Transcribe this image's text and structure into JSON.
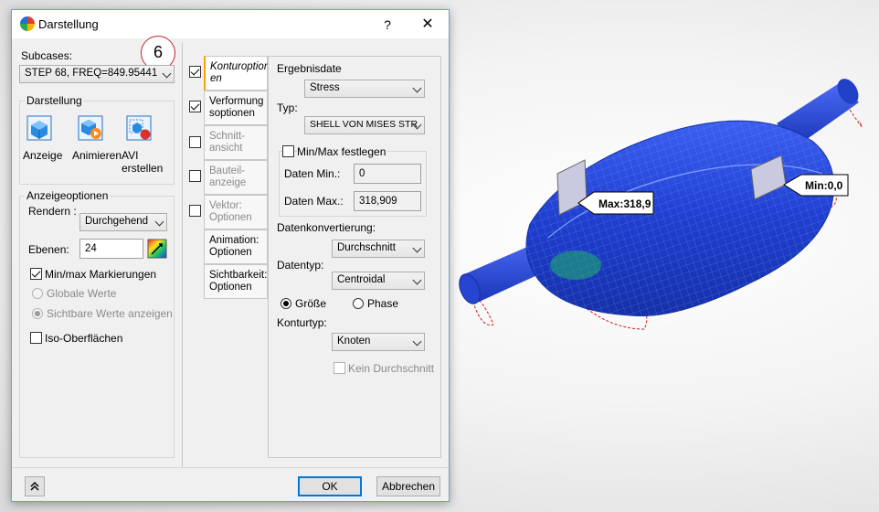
{
  "dialog": {
    "title": "Darstellung",
    "help_label": "?",
    "close_label": "✕",
    "callout_number": "6"
  },
  "left": {
    "subcases_label": "Subcases:",
    "subcase_value": "STEP 68, FREQ=849.95441",
    "darstellung_group": "Darstellung",
    "buttons": {
      "anzeige": "Anzeige",
      "animieren": "Animieren",
      "avi_line1": "AVI",
      "avi_line2": "erstellen"
    },
    "anzeigeoptionen_group": "Anzeigeoptionen",
    "rendern_label": "Rendern :",
    "rendern_value": "Durchgehend",
    "ebenen_label": "Ebenen:",
    "ebenen_value": "24",
    "minmax_label": "Min/max Markierungen",
    "globale_werte": "Globale Werte",
    "sichtbare_werte": "Sichtbare Werte anzeigen",
    "iso_label": "Iso-Oberflächen"
  },
  "tabs": [
    {
      "line1": "Konturoption",
      "line2": "en"
    },
    {
      "line1": "Verformung",
      "line2": "soptionen"
    },
    {
      "line1": "Schnitt-",
      "line2": "ansicht"
    },
    {
      "line1": "Bauteil-",
      "line2": "anzeige"
    },
    {
      "line1": "Vektor:",
      "line2": "Optionen"
    },
    {
      "line1": "Animation:",
      "line2": "Optionen"
    },
    {
      "line1": "Sichtbarkeit:",
      "line2": "Optionen"
    }
  ],
  "contour": {
    "ergebnisdatei_label": "Ergebnisdate",
    "ergebnisdatei_value": "Stress",
    "typ_label": "Typ:",
    "typ_value": "SHELL VON MISES STR",
    "minmax_fix_label": "Min/Max festlegen",
    "daten_min_label": "Daten Min.:",
    "daten_min_value": "0",
    "daten_max_label": "Daten Max.:",
    "daten_max_value": "318,909",
    "datenkonv_label": "Datenkonvertierung:",
    "datenkonv_value": "Durchschnitt",
    "datentyp_label": "Datentyp:",
    "datentyp_value": "Centroidal",
    "groesse_label": "Größe",
    "phase_label": "Phase",
    "konturtyp_label": "Konturtyp:",
    "konturtyp_value": "Knoten",
    "kein_durchschnitt_label": "Kein Durchschnitt"
  },
  "footer": {
    "ok_label": "OK",
    "abbrechen_label": "Abbrechen",
    "collapse_icon": "double-chevron-up-icon"
  },
  "viewport": {
    "max_label": "Max:318,9",
    "min_label": "Min:0,0"
  },
  "colors": {
    "mesh_blue": "#1f3fd0",
    "accent_orange": "#ffa000",
    "callout_red": "#c0282d",
    "default_button": "#0078d7"
  }
}
